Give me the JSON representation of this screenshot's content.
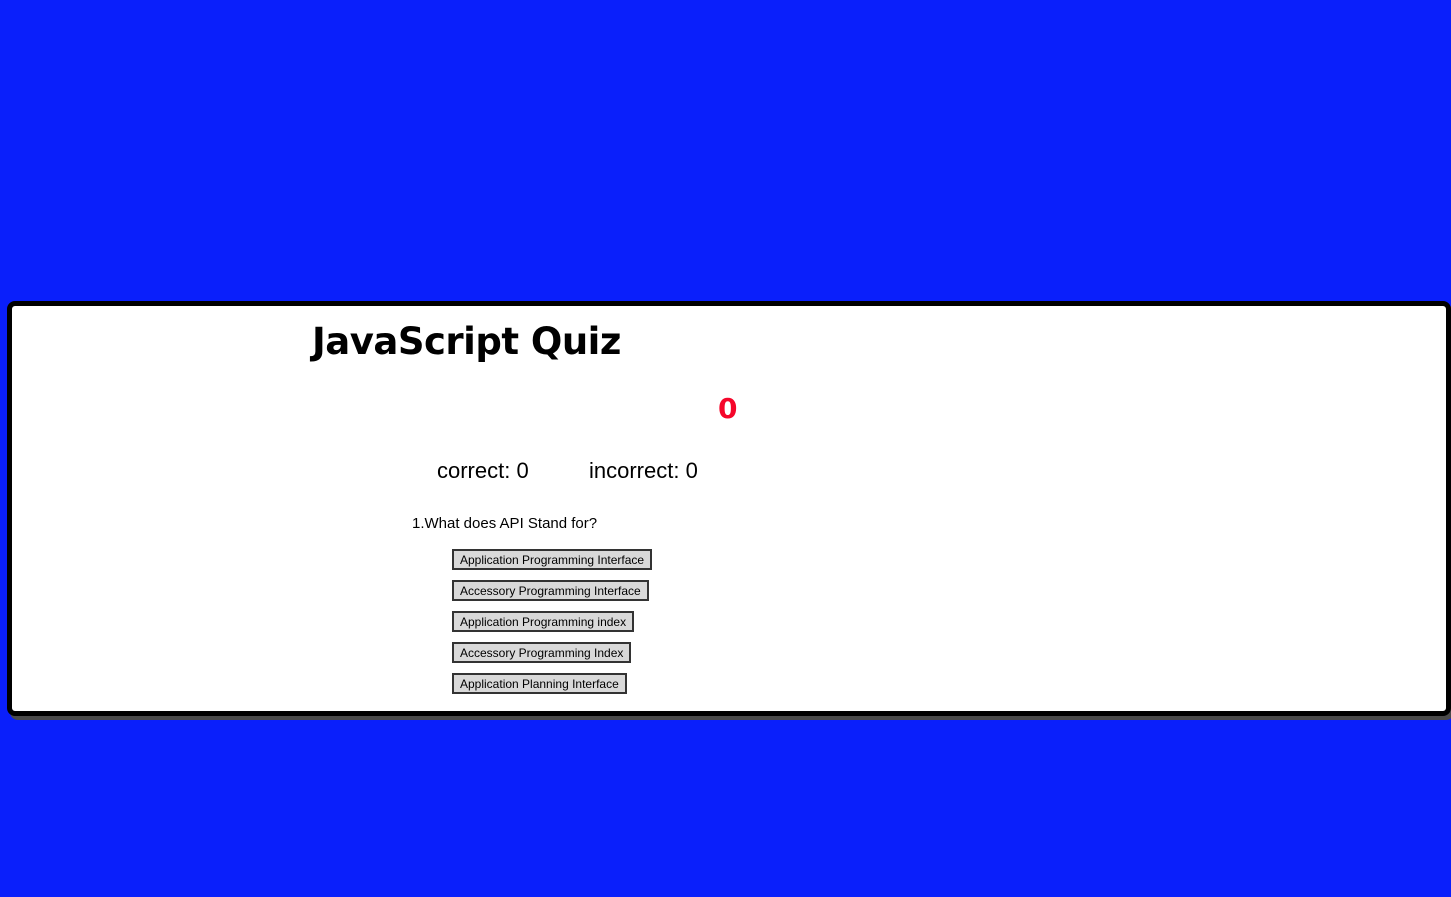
{
  "quiz": {
    "title": "JavaScript Quiz",
    "timer": "0",
    "correct_text": "correct: 0",
    "incorrect_text": "incorrect: 0",
    "question_text": "1.What does API Stand for?",
    "answers": [
      "Application Programming Interface",
      "Accessory Programming Interface",
      "Application Programming index",
      "Accessory Programming Index",
      "Application Planning Interface"
    ]
  },
  "colors": {
    "background": "#0a1ffb",
    "card": "#ffffff",
    "timer": "#f5062a",
    "button": "#d9d9d9"
  }
}
